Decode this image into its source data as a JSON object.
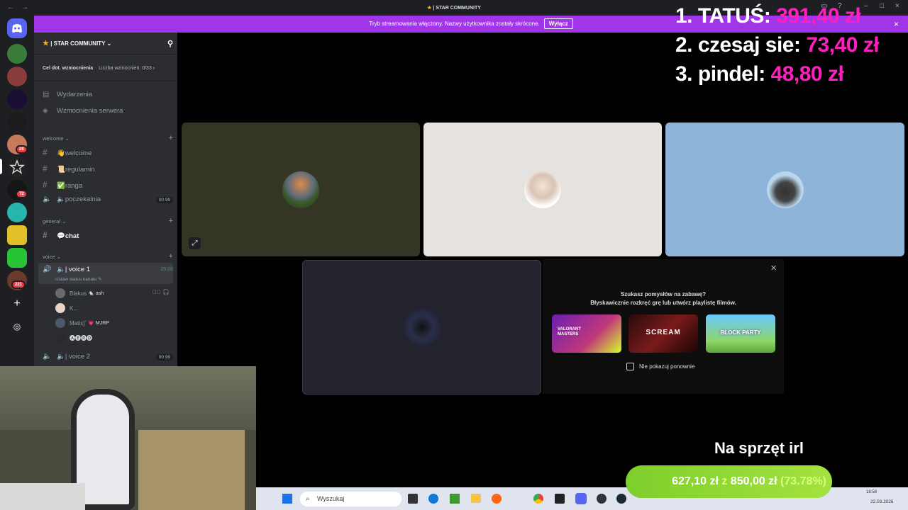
{
  "titlebar": {
    "title": "| STAR COMMUNITY",
    "back": "←",
    "fwd": "→"
  },
  "streamer": {
    "message": "Tryb streamowania włączony. Nazwy użytkownika zostały skrócone.",
    "button": "Wyłącz",
    "close": "×"
  },
  "rail": {
    "badges": [
      "28",
      "72",
      "221"
    ],
    "colors": {
      "bg": "#1e1f22",
      "discord": "#5865f2"
    }
  },
  "server": {
    "name": "| STAR COMMUNITY",
    "boost_goal": "Cel dot. wzmocnienia",
    "boost_count": "Liczba wzmocnień: 0/33"
  },
  "sidebar": {
    "events": "Wydarzenia",
    "boosts": "Wzmocnienia serwera",
    "categories": {
      "welcome": "welcome",
      "general": "general",
      "voice": "voice"
    },
    "channels": {
      "welcome": "👋welcome",
      "regulamin": "📜regulamin",
      "ranga": "✅ranga",
      "poczekalnia": "poczekalnia",
      "poczekalnia_count": "00 99",
      "chat": "💬chat",
      "voice1": "| voice 1",
      "voice1_time": "25:08",
      "voice1_status": "Ustaw status kanału",
      "voice2": "| voice 2",
      "voice2_count": "00 99"
    },
    "users": [
      {
        "name": "Blakus",
        "tag": "🐁 ash"
      },
      {
        "name": "K...",
        "tag": ""
      },
      {
        "name": "Matix]`",
        "tag": "💗 MJRP"
      },
      {
        "name": "🅐🅔🅡🅓",
        "tag": ""
      }
    ]
  },
  "suggest": {
    "line1": "Szukasz pomysłów na zabawę?",
    "line2": "Błyskawicznie rozkręć grę lub utwórz playlistę filmów.",
    "checkbox": "Nie pokazuj ponownie",
    "close": "×",
    "games": [
      "VALORANT MASTERS",
      "SCREAM",
      "BLOCK PARTY"
    ]
  },
  "leaderboard": [
    {
      "rank": "1.",
      "name": "TATUŚ:",
      "amount": "391,40 zł"
    },
    {
      "rank": "2.",
      "name": "czesaj sie:",
      "amount": "73,40 zł"
    },
    {
      "rank": "3.",
      "name": "pindel:",
      "amount": "48,80 zł"
    }
  ],
  "goal": {
    "title": "Na sprzęt irl",
    "current": "627,10 zł",
    "sep": "z",
    "target": "850,00 zł",
    "percent_label": "(73.78%)",
    "progress": 0.7378
  },
  "taskbar": {
    "search_placeholder": "Wyszukaj",
    "date": "22.03.2026",
    "time": "18:58"
  }
}
